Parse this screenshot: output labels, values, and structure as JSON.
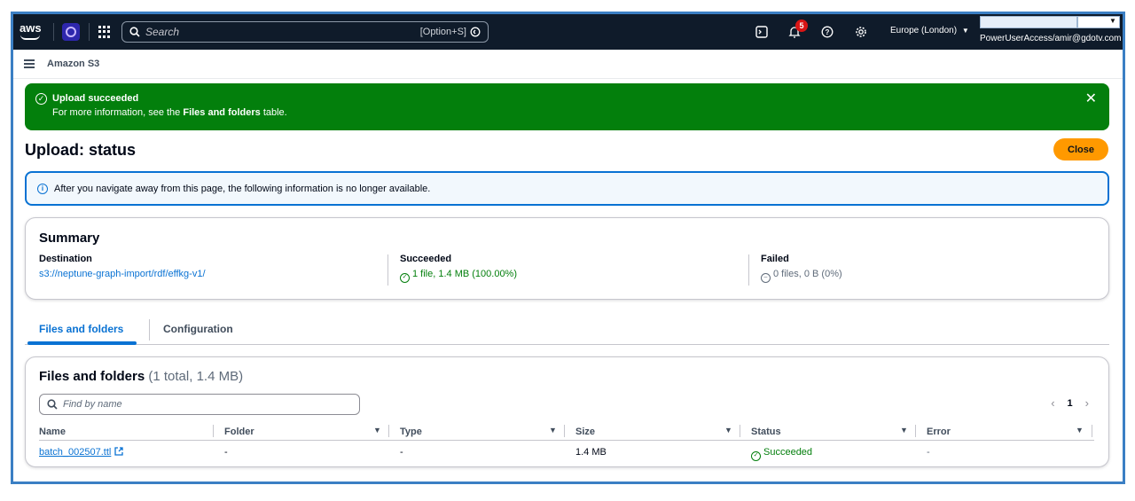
{
  "topnav": {
    "logo_text": "aws",
    "search_placeholder": "Search",
    "search_shortcut": "[Option+S]",
    "notifications_count": "5",
    "region": "Europe (London)",
    "account_user": "PowerUserAccess/amir@gdotv.com"
  },
  "service": {
    "title": "Amazon S3"
  },
  "flash": {
    "title": "Upload succeeded",
    "body_prefix": "For more information, see the ",
    "body_link": "Files and folders",
    "body_suffix": " table."
  },
  "header": {
    "title": "Upload: status",
    "close_label": "Close"
  },
  "info": {
    "text": "After you navigate away from this page, the following information is no longer available."
  },
  "summary": {
    "title": "Summary",
    "destination_label": "Destination",
    "destination_value": "s3://neptune-graph-import/rdf/effkg-v1/",
    "succeeded_label": "Succeeded",
    "succeeded_value": "1 file, 1.4 MB (100.00%)",
    "failed_label": "Failed",
    "failed_value": "0 files, 0 B (0%)"
  },
  "tabs": [
    {
      "label": "Files and folders"
    },
    {
      "label": "Configuration"
    }
  ],
  "files": {
    "title": "Files and folders",
    "count": "(1 total, 1.4 MB)",
    "find_placeholder": "Find by name",
    "page": "1",
    "columns": [
      "Name",
      "Folder",
      "Type",
      "Size",
      "Status",
      "Error"
    ],
    "rows": [
      {
        "name": "batch_002507.ttl",
        "folder": "-",
        "type": "-",
        "size": "1.4 MB",
        "status": "Succeeded",
        "error": "-"
      }
    ]
  },
  "colors": {
    "success": "#037f0c",
    "link": "#0972d3",
    "primary": "#ff9900",
    "nav": "#0f1b2a"
  }
}
